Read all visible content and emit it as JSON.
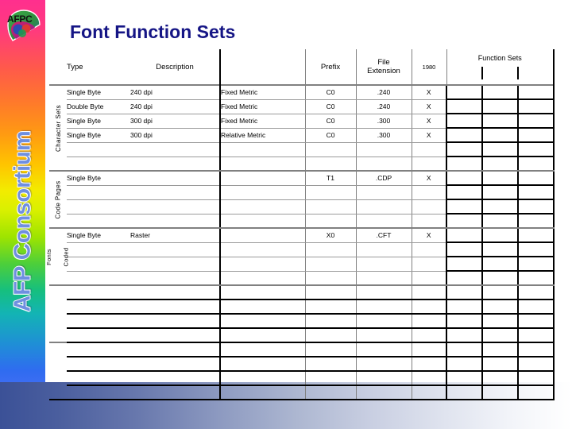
{
  "sidebar": {
    "logo_text": "AFPC",
    "logo_icon": "afpc-logo-icon",
    "vertical_title": "AFP Consortium",
    "gradient_colors": [
      "#ff2f8e",
      "#ff9a12",
      "#f2ec00",
      "#4dcf3a",
      "#13b4b4",
      "#3b6df2"
    ]
  },
  "bottom_bar": {
    "gradient_from": "#3b5197",
    "gradient_to": "#ffffff"
  },
  "title": {
    "text": "Font Function Sets",
    "color": "#151585"
  },
  "table": {
    "headers": {
      "type": "Type",
      "description": "Description",
      "metric": "",
      "prefix": "Prefix",
      "file_extension_line1": "File",
      "file_extension_line2": "Extension",
      "year_1980": "1980",
      "function_sets_group": "Function Sets",
      "fs_col_1": "",
      "fs_col_2": "",
      "fs_col_3": ""
    },
    "sections": [
      {
        "label": "Character Sets",
        "rows": [
          {
            "type": "Single Byte",
            "description": "240 dpi",
            "metric": "Fixed Metric",
            "prefix": "C0",
            "extension": ".240",
            "y1980": "X",
            "fs1": "",
            "fs2": "",
            "fs3": ""
          },
          {
            "type": "Double Byte",
            "description": "240 dpi",
            "metric": "Fixed Metric",
            "prefix": "C0",
            "extension": ".240",
            "y1980": "X",
            "fs1": "",
            "fs2": "",
            "fs3": ""
          },
          {
            "type": "Single Byte",
            "description": "300 dpi",
            "metric": "Fixed Metric",
            "prefix": "C0",
            "extension": ".300",
            "y1980": "X",
            "fs1": "",
            "fs2": "",
            "fs3": ""
          },
          {
            "type": "Single Byte",
            "description": "300 dpi",
            "metric": "Relative Metric",
            "prefix": "C0",
            "extension": ".300",
            "y1980": "X",
            "fs1": "",
            "fs2": "",
            "fs3": ""
          },
          {
            "type": "",
            "description": "",
            "metric": "",
            "prefix": "",
            "extension": "",
            "y1980": "",
            "fs1": "",
            "fs2": "",
            "fs3": ""
          },
          {
            "type": "",
            "description": "",
            "metric": "",
            "prefix": "",
            "extension": "",
            "y1980": "",
            "fs1": "",
            "fs2": "",
            "fs3": ""
          }
        ]
      },
      {
        "label": "Code Pages",
        "rows": [
          {
            "type": "Single Byte",
            "description": "",
            "metric": "",
            "prefix": "T1",
            "extension": ".CDP",
            "y1980": "X",
            "fs1": "",
            "fs2": "",
            "fs3": ""
          },
          {
            "type": "",
            "description": "",
            "metric": "",
            "prefix": "",
            "extension": "",
            "y1980": "",
            "fs1": "",
            "fs2": "",
            "fs3": ""
          },
          {
            "type": "",
            "description": "",
            "metric": "",
            "prefix": "",
            "extension": "",
            "y1980": "",
            "fs1": "",
            "fs2": "",
            "fs3": ""
          },
          {
            "type": "",
            "description": "",
            "metric": "",
            "prefix": "",
            "extension": "",
            "y1980": "",
            "fs1": "",
            "fs2": "",
            "fs3": ""
          }
        ]
      },
      {
        "label": "Coded Fonts",
        "label_line1": "Coded",
        "label_line2": "Fonts",
        "rows": [
          {
            "type": "Single Byte",
            "description": "Raster",
            "metric": "",
            "prefix": "X0",
            "extension": ".CFT",
            "y1980": "X",
            "fs1": "",
            "fs2": "",
            "fs3": ""
          },
          {
            "type": "",
            "description": "",
            "metric": "",
            "prefix": "",
            "extension": "",
            "y1980": "",
            "fs1": "",
            "fs2": "",
            "fs3": ""
          },
          {
            "type": "",
            "description": "",
            "metric": "",
            "prefix": "",
            "extension": "",
            "y1980": "",
            "fs1": "",
            "fs2": "",
            "fs3": ""
          },
          {
            "type": "",
            "description": "",
            "metric": "",
            "prefix": "",
            "extension": "",
            "y1980": "",
            "fs1": "",
            "fs2": "",
            "fs3": ""
          }
        ]
      },
      {
        "label": "",
        "rows": [
          {
            "type": "",
            "description": "",
            "metric": "",
            "prefix": "",
            "extension": "",
            "y1980": "",
            "fs1": "",
            "fs2": "",
            "fs3": ""
          },
          {
            "type": "",
            "description": "",
            "metric": "",
            "prefix": "",
            "extension": "",
            "y1980": "",
            "fs1": "",
            "fs2": "",
            "fs3": ""
          },
          {
            "type": "",
            "description": "",
            "metric": "",
            "prefix": "",
            "extension": "",
            "y1980": "",
            "fs1": "",
            "fs2": "",
            "fs3": ""
          },
          {
            "type": "",
            "description": "",
            "metric": "",
            "prefix": "",
            "extension": "",
            "y1980": "",
            "fs1": "",
            "fs2": "",
            "fs3": ""
          }
        ]
      },
      {
        "label": "",
        "rows": [
          {
            "type": "",
            "description": "",
            "metric": "",
            "prefix": "",
            "extension": "",
            "y1980": "",
            "fs1": "",
            "fs2": "",
            "fs3": ""
          },
          {
            "type": "",
            "description": "",
            "metric": "",
            "prefix": "",
            "extension": "",
            "y1980": "",
            "fs1": "",
            "fs2": "",
            "fs3": ""
          },
          {
            "type": "",
            "description": "",
            "metric": "",
            "prefix": "",
            "extension": "",
            "y1980": "",
            "fs1": "",
            "fs2": "",
            "fs3": ""
          },
          {
            "type": "",
            "description": "",
            "metric": "",
            "prefix": "",
            "extension": "",
            "y1980": "",
            "fs1": "",
            "fs2": "",
            "fs3": ""
          }
        ]
      }
    ]
  }
}
